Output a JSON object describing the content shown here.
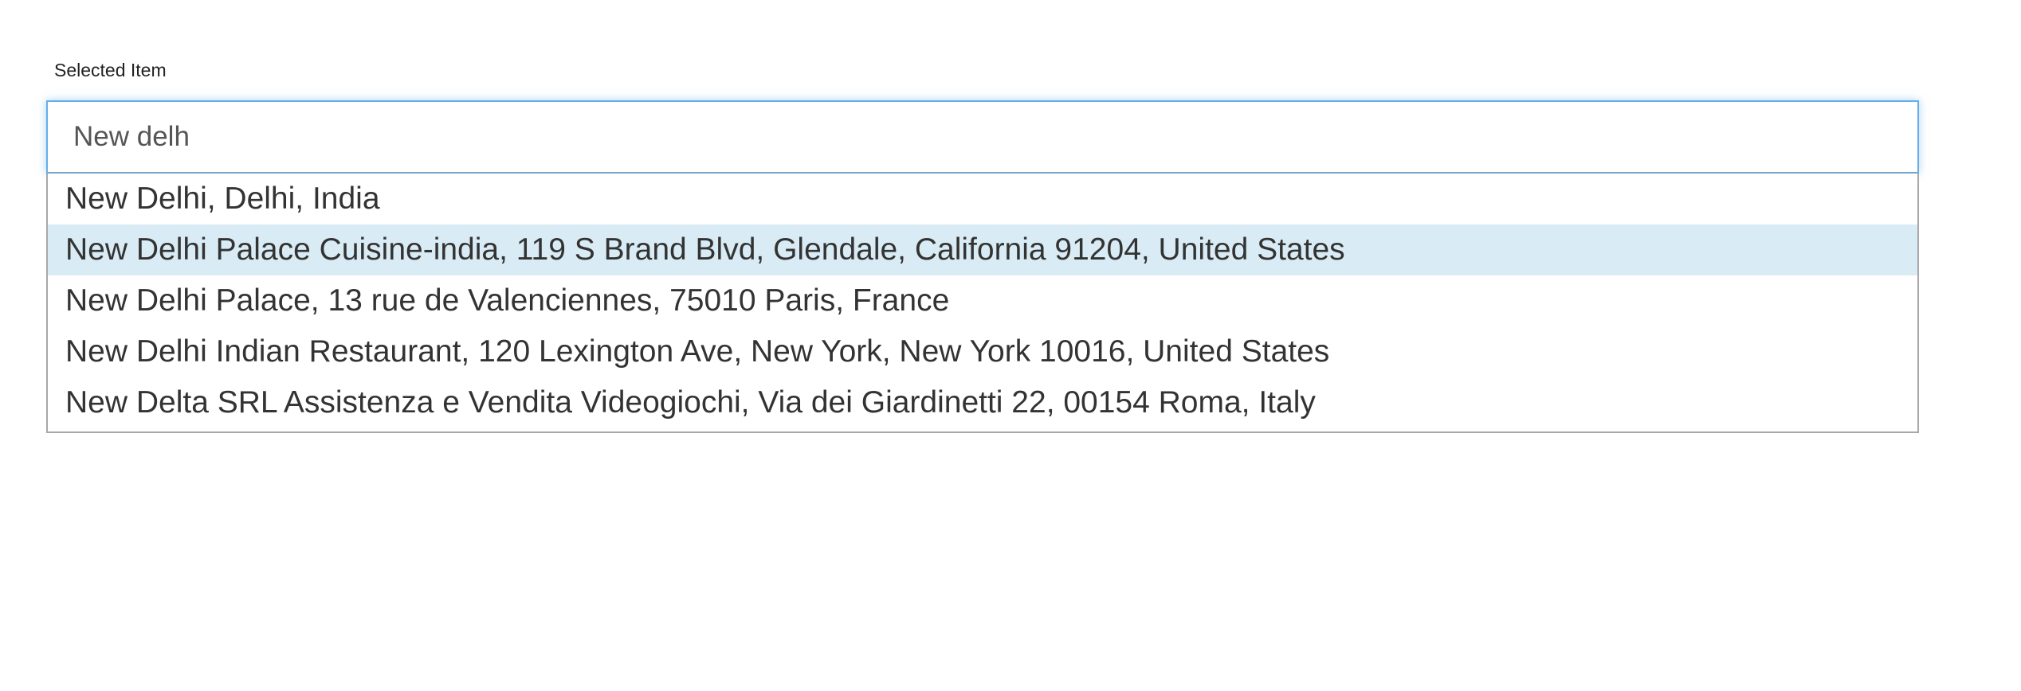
{
  "field": {
    "label": "Selected Item",
    "value": "New delh"
  },
  "suggestions": [
    {
      "text": "New Delhi, Delhi, India",
      "active": false
    },
    {
      "text": "New Delhi Palace Cuisine-india, 119 S Brand Blvd, Glendale, California 91204, United States",
      "active": true
    },
    {
      "text": "New Delhi Palace, 13 rue de Valenciennes, 75010 Paris, France",
      "active": false
    },
    {
      "text": "New Delhi Indian Restaurant, 120 Lexington Ave, New York, New York 10016, United States",
      "active": false
    },
    {
      "text": "New Delta SRL Assistenza e Vendita Videogiochi, Via dei Giardinetti 22, 00154 Roma, Italy",
      "active": false
    }
  ],
  "colors": {
    "focus_border": "#66afe9",
    "active_item_background": "#d9ecf5",
    "list_border": "#a8a8a8"
  }
}
